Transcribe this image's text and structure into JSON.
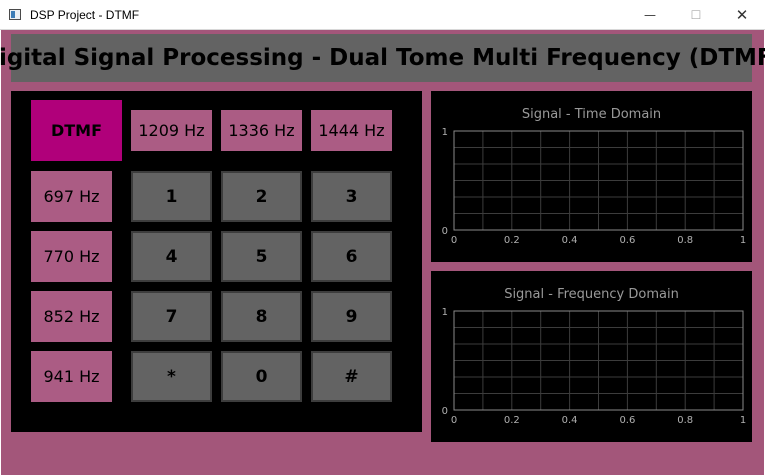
{
  "window": {
    "title": "DSP Project - DTMF",
    "minimize_glyph": "—",
    "maximize_glyph": "☐",
    "close_glyph": "✕"
  },
  "header": {
    "title": "Digital Signal Processing - Dual Tome Multi Frequency (DTMF)"
  },
  "keypad": {
    "dtmf_label": "DTMF",
    "col_freqs": [
      "1209 Hz",
      "1336 Hz",
      "1444 Hz"
    ],
    "row_freqs": [
      "697 Hz",
      "770 Hz",
      "852 Hz",
      "941 Hz"
    ],
    "keys": [
      [
        "1",
        "2",
        "3"
      ],
      [
        "4",
        "5",
        "6"
      ],
      [
        "7",
        "8",
        "9"
      ],
      [
        "*",
        "0",
        "#"
      ]
    ]
  },
  "plots": [
    {
      "title": "Signal - Time Domain",
      "x_ticks": [
        "0",
        "0.2",
        "0.4",
        "0.6",
        "0.8",
        "1"
      ],
      "y_ticks": [
        "0",
        "1"
      ]
    },
    {
      "title": "Signal - Frequency Domain",
      "x_ticks": [
        "0",
        "0.2",
        "0.4",
        "0.6",
        "0.8",
        "1"
      ],
      "y_ticks": [
        "0",
        "1"
      ]
    }
  ],
  "colors": {
    "background": "#a3567a",
    "header": "#636363",
    "dtmf_button": "#b0007a",
    "freq_label": "#ab5c84",
    "key_button": "#636363",
    "panel": "#000000"
  }
}
